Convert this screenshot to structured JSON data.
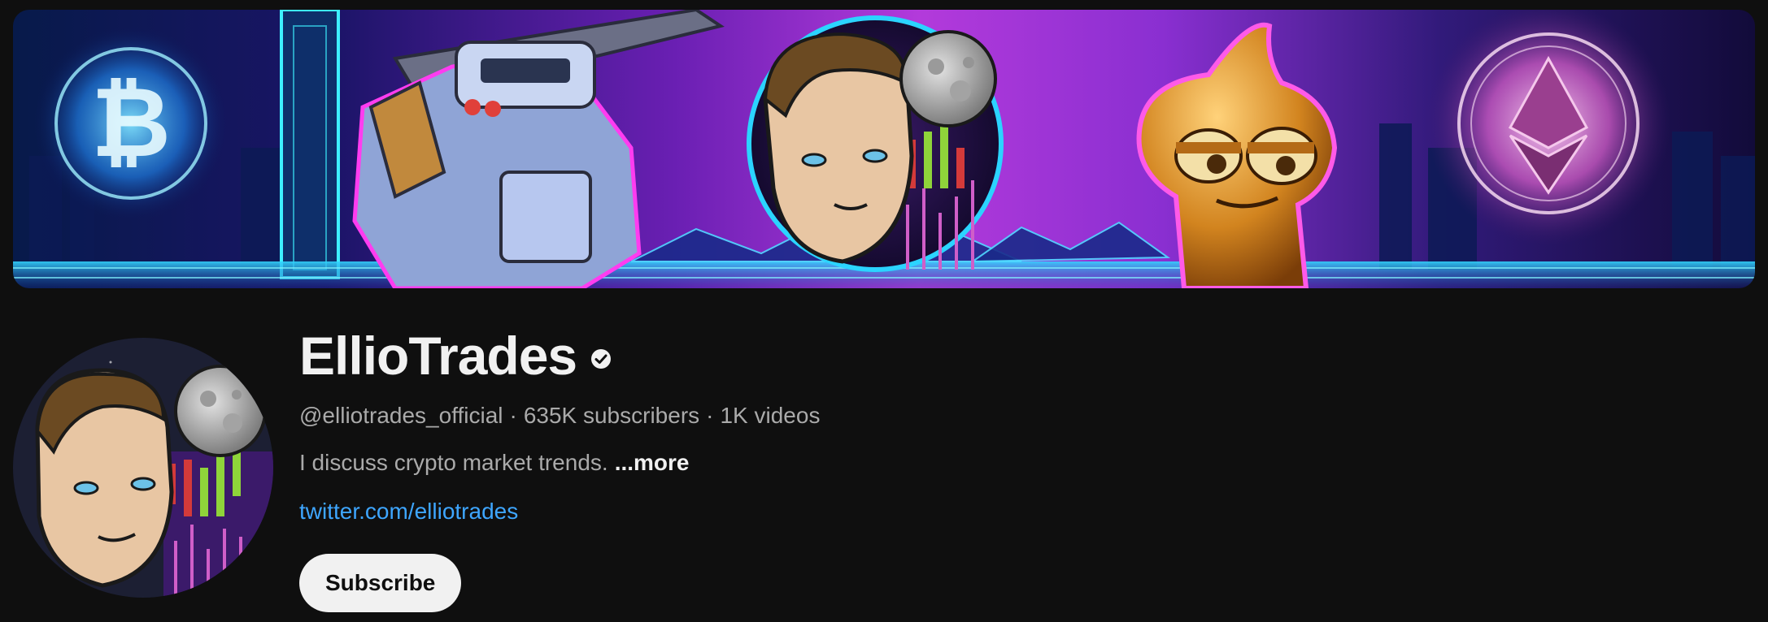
{
  "channel": {
    "name": "EllioTrades",
    "verified": true,
    "handle": "@elliotrades_official",
    "subscribers": "635K subscribers",
    "videos": "1K videos",
    "separator": "·",
    "description": "I discuss crypto market trends.",
    "more_label": "...more",
    "link": "twitter.com/elliotrades",
    "subscribe_label": "Subscribe"
  },
  "banner": {
    "left_coin": "bitcoin-icon",
    "right_coin": "ethereum-icon"
  },
  "colors": {
    "background": "#0f0f0f",
    "text_primary": "#f1f1f1",
    "text_secondary": "#aaaaaa",
    "link": "#3ea6ff",
    "button_bg": "#f1f1f1",
    "button_text": "#0f0f0f"
  }
}
